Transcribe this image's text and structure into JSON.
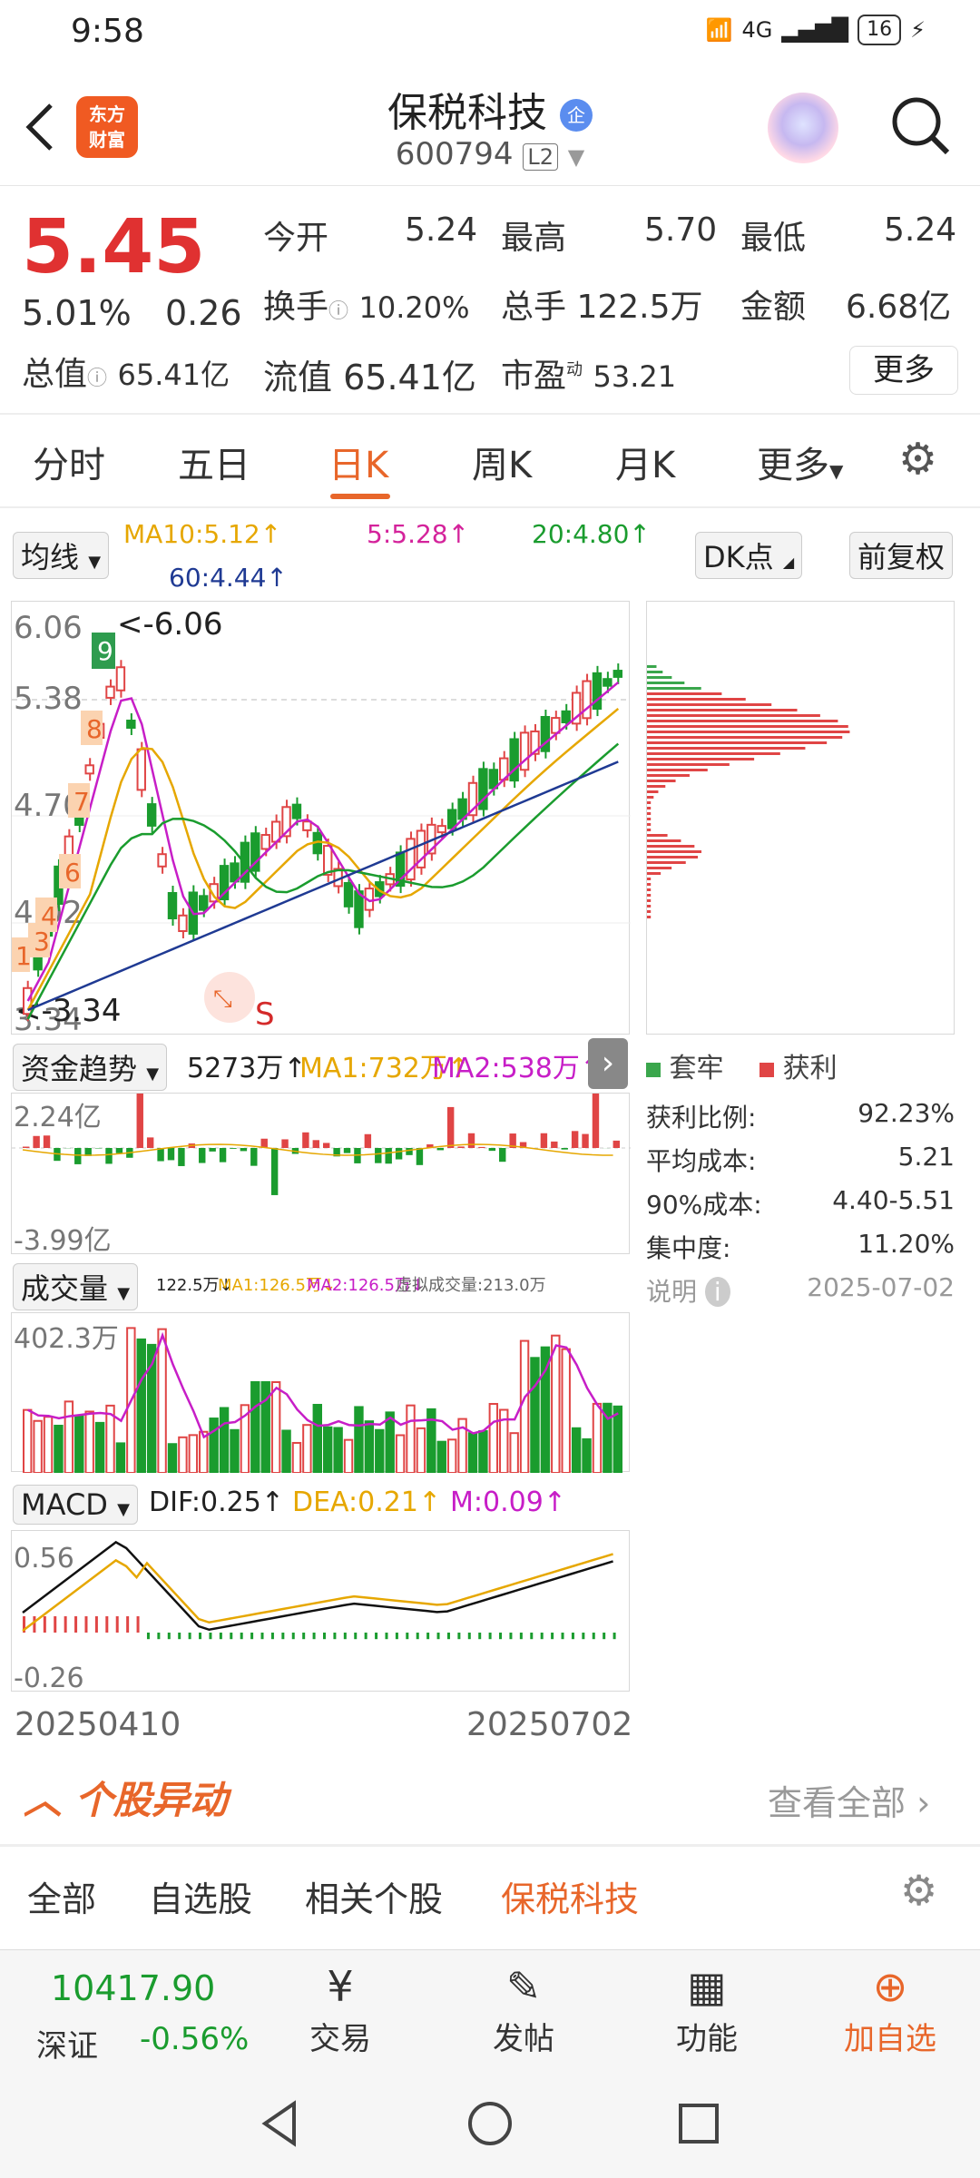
{
  "status": {
    "time": "9:58",
    "net": "4G",
    "battery": "16"
  },
  "header": {
    "logo_line1": "东方",
    "logo_line2": "财富",
    "title": "保税科技",
    "badge": "企",
    "code": "600794",
    "level": "L2"
  },
  "quote": {
    "price": "5.45",
    "pct": "5.01%",
    "chg": "0.26",
    "open_label": "今开",
    "open": "5.24",
    "high_label": "最高",
    "high": "5.70",
    "low_label": "最低",
    "low": "5.24",
    "turnover_label": "换手",
    "turnover": "10.20%",
    "volume_label": "总手",
    "volume": "122.5万",
    "amount_label": "金额",
    "amount": "6.68亿",
    "mcap_label": "总值",
    "mcap": "65.41亿",
    "float_label": "流值",
    "float": "65.41亿",
    "pe_label": "市盈",
    "pe_sup": "动",
    "pe": "53.21",
    "more": "更多"
  },
  "tabs": [
    "分时",
    "五日",
    "日K",
    "周K",
    "月K",
    "更多"
  ],
  "controls": {
    "ma_btn": "均线",
    "ma10": "MA10:5.12↑",
    "ma5": "5:5.28↑",
    "ma20": "20:4.80↑",
    "ma60": "60:4.44↑",
    "dk": "DK点",
    "fq": "前复权"
  },
  "kline": {
    "y_labels": [
      "6.06",
      "5.38",
      "4.70",
      "4.02",
      "3.34"
    ],
    "max_mark": "<-6.06",
    "min_mark": "<-3.34",
    "s_mark": "S",
    "signals": [
      "9",
      "8",
      "7",
      "6",
      "4",
      "3",
      "1"
    ]
  },
  "chip": {
    "legend_trapped": "套牢",
    "legend_profit": "获利",
    "rows": [
      {
        "k": "获利比例:",
        "v": "92.23%"
      },
      {
        "k": "平均成本:",
        "v": "5.21"
      },
      {
        "k": "90%成本:",
        "v": "4.40-5.51"
      },
      {
        "k": "集中度:",
        "v": "11.20%"
      }
    ],
    "note": "说明",
    "date": "2025-07-02"
  },
  "fund": {
    "btn": "资金趋势",
    "val": "5273万↑",
    "ma1": "MA1:732万↑",
    "ma2": "MA2:538万↑",
    "top": "2.24亿",
    "bottom": "-3.99亿"
  },
  "vol": {
    "btn": "成交量",
    "val": "122.5万↓",
    "ma1": "MA1:126.5万↓",
    "ma2": "MA2:126.5万↓",
    "virtual": "虚拟成交量:213.0万",
    "top": "402.3万"
  },
  "macd": {
    "btn": "MACD",
    "dif": "DIF:0.25↑",
    "dea": "DEA:0.21↑",
    "m": "M:0.09↑",
    "top": "0.56",
    "bottom": "-0.26"
  },
  "dates": {
    "start": "20250410",
    "end": "20250702"
  },
  "movement": {
    "title": "个股异动",
    "view_all": "查看全部"
  },
  "filters": [
    "全部",
    "自选股",
    "相关个股",
    "保税科技"
  ],
  "bottom": {
    "index_value": "10417.90",
    "index_name": "深证",
    "index_chg": "-0.56%",
    "trade": "交易",
    "post": "发帖",
    "func": "功能",
    "add": "加自选"
  }
}
